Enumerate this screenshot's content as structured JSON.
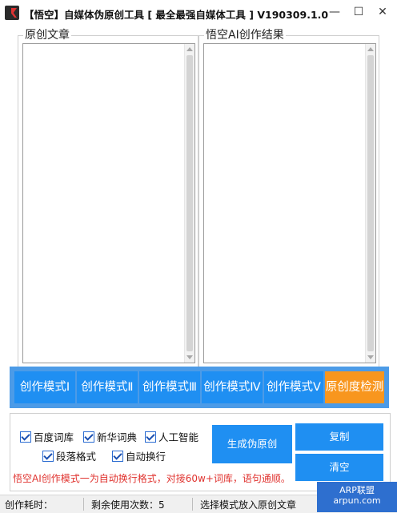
{
  "window": {
    "title": "【悟空】自媒体伪原创工具 [ 最全最强自媒体工具 ] V190309.1.0",
    "minimize_glyph": "—",
    "maximize_glyph": "☐",
    "close_glyph": "✕"
  },
  "panels": {
    "original_label": "原创文章",
    "result_label": "悟空AI创作结果",
    "original_text": "",
    "result_text": ""
  },
  "modes": [
    {
      "label": "创作模式Ⅰ"
    },
    {
      "label": "创作模式Ⅱ"
    },
    {
      "label": "创作模式Ⅲ"
    },
    {
      "label": "创作模式Ⅳ"
    },
    {
      "label": "创作模式Ⅴ"
    },
    {
      "label": "原创度检测"
    }
  ],
  "options": [
    {
      "label": "百度词库",
      "checked": true
    },
    {
      "label": "新华词典",
      "checked": true
    },
    {
      "label": "人工智能",
      "checked": true
    },
    {
      "label": "段落格式",
      "checked": true
    },
    {
      "label": "自动换行",
      "checked": true
    }
  ],
  "actions": {
    "generate": "生成伪原创",
    "copy": "复制",
    "clear": "清空"
  },
  "notice": "悟空AI创作模式一为自动换行格式，对接60w+词库，语句通顺。",
  "status": {
    "elapsed": "创作耗时：",
    "remaining": "剩余使用次数：5",
    "hint": "选择模式放入原创文章"
  },
  "watermark": {
    "line1": "ARP联盟",
    "line2": "arpun.com"
  },
  "colors": {
    "mode_bar": "#4c9be7",
    "button_blue": "#1f8ff2",
    "button_orange": "#f8961e",
    "notice_red": "#e0332f"
  }
}
